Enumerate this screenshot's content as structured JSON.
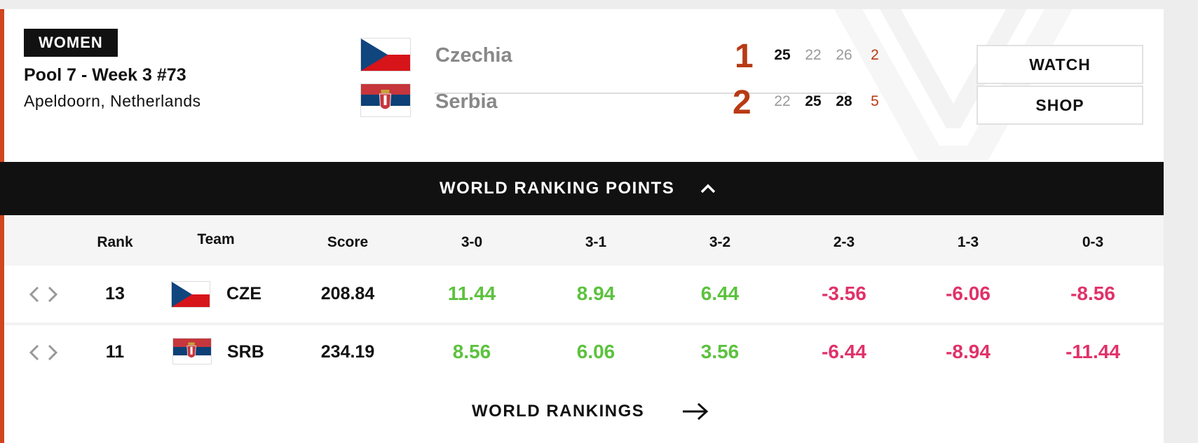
{
  "match": {
    "category": "WOMEN",
    "pool": "Pool 7 - Week 3 #73",
    "venue": "Apeldoorn, Netherlands",
    "home": {
      "name": "Czechia",
      "sets_won": "1",
      "set_scores": [
        "25",
        "22",
        "26"
      ],
      "total": "2",
      "flag_icon": "czech-flag"
    },
    "away": {
      "name": "Serbia",
      "sets_won": "2",
      "set_scores": [
        "22",
        "25",
        "28"
      ],
      "total": "5",
      "flag_icon": "serbia-flag"
    }
  },
  "buttons": {
    "watch": "WATCH",
    "shop": "SHOP"
  },
  "ranking": {
    "title": "WORLD RANKING POINTS",
    "columns": [
      "Rank",
      "Team",
      "Score",
      "3-0",
      "3-1",
      "3-2",
      "2-3",
      "1-3",
      "0-3"
    ],
    "rows": [
      {
        "rank": "13",
        "code": "CZE",
        "score": "208.84",
        "points": [
          "11.44",
          "8.94",
          "6.44",
          "-3.56",
          "-6.06",
          "-8.56"
        ]
      },
      {
        "rank": "11",
        "code": "SRB",
        "score": "234.19",
        "points": [
          "8.56",
          "6.06",
          "3.56",
          "-6.44",
          "-8.94",
          "-11.44"
        ]
      }
    ],
    "footer_link": "WORLD RANKINGS"
  },
  "colors": {
    "accent": "#d0461e",
    "score": "#b83a14",
    "positive": "#5cc23e",
    "negative": "#e0326a",
    "bar": "#111111"
  }
}
